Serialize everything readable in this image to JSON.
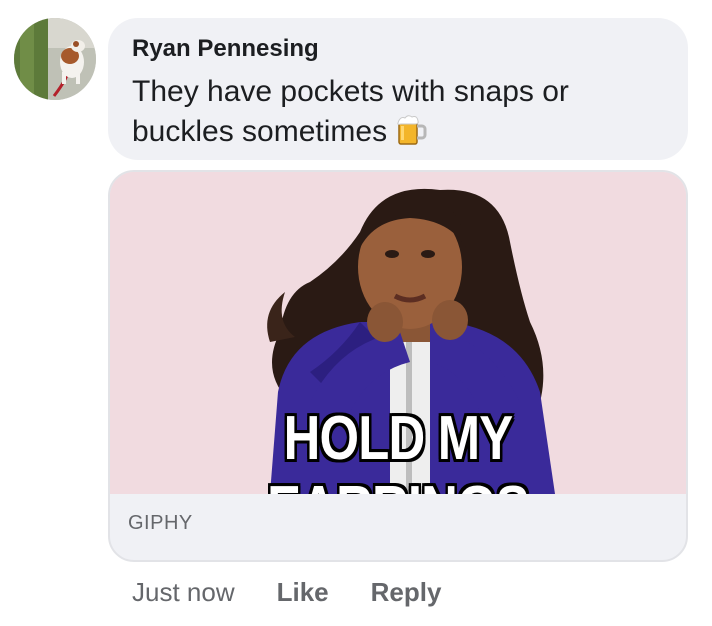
{
  "comment": {
    "author": "Ryan Pennesing",
    "message": "They have pockets with snaps or buckles sometimes",
    "emoji": "beer-mug-icon"
  },
  "attachment": {
    "caption": "HOLD MY EARRINGS",
    "source": "GIPHY"
  },
  "actions": {
    "timestamp": "Just now",
    "like_label": "Like",
    "reply_label": "Reply"
  },
  "colors": {
    "bubble_bg": "#f0f1f5",
    "text_primary": "#1c1e21",
    "text_secondary": "#65676b",
    "gif_bg": "#f1dbe0",
    "hoodie": "#3a2a9a"
  }
}
